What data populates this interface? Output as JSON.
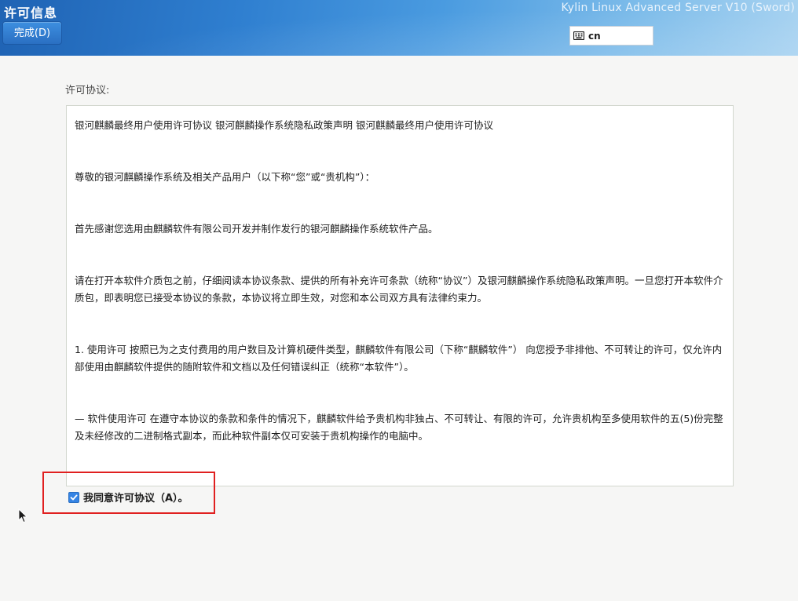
{
  "header": {
    "title": "许可信息",
    "done_label": "完成(D)",
    "product": "Kylin Linux Advanced Server V10 (Sword)",
    "keyboard": {
      "icon": "keyboard-icon",
      "label": "cn"
    }
  },
  "license": {
    "section_label": "许可协议:",
    "paragraphs": [
      "银河麒麟最终用户使用许可协议 银河麒麟操作系统隐私政策声明 银河麒麟最终用户使用许可协议",
      " 尊敬的银河麒麟操作系统及相关产品用户（以下称“您”或“贵机构”）：",
      " 首先感谢您选用由麒麟软件有限公司开发并制作发行的银河麒麟操作系统软件产品。",
      " 请在打开本软件介质包之前，仔细阅读本协议条款、提供的所有补充许可条款（统称“协议”）及银河麒麟操作系统隐私政策声明。一旦您打开本软件介质包，即表明您已接受本协议的条款，本协议将立即生效，对您和本公司双方具有法律约束力。",
      " 1. 使用许可 按照已为之支付费用的用户数目及计算机硬件类型，麒麟软件有限公司（下称“麒麟软件”） 向您授予非排他、不可转让的许可，仅允许内部使用由麒麟软件提供的随附软件和文档以及任何错误纠正（统称“本软件”）。",
      " — 软件使用许可 在遵守本协议的条款和条件的情况下，麒麟软件给予贵机构非独占、不可转让、有限的许可，允许贵机构至多使用软件的五(5)份完整及未经修改的二进制格式副本，而此种软件副本仅可安装于贵机构操作的电脑中。"
    ]
  },
  "agree": {
    "label": "我同意许可协议（A）。",
    "checked": true
  },
  "colors": {
    "accent": "#3584e4",
    "highlight": "#e02020"
  }
}
